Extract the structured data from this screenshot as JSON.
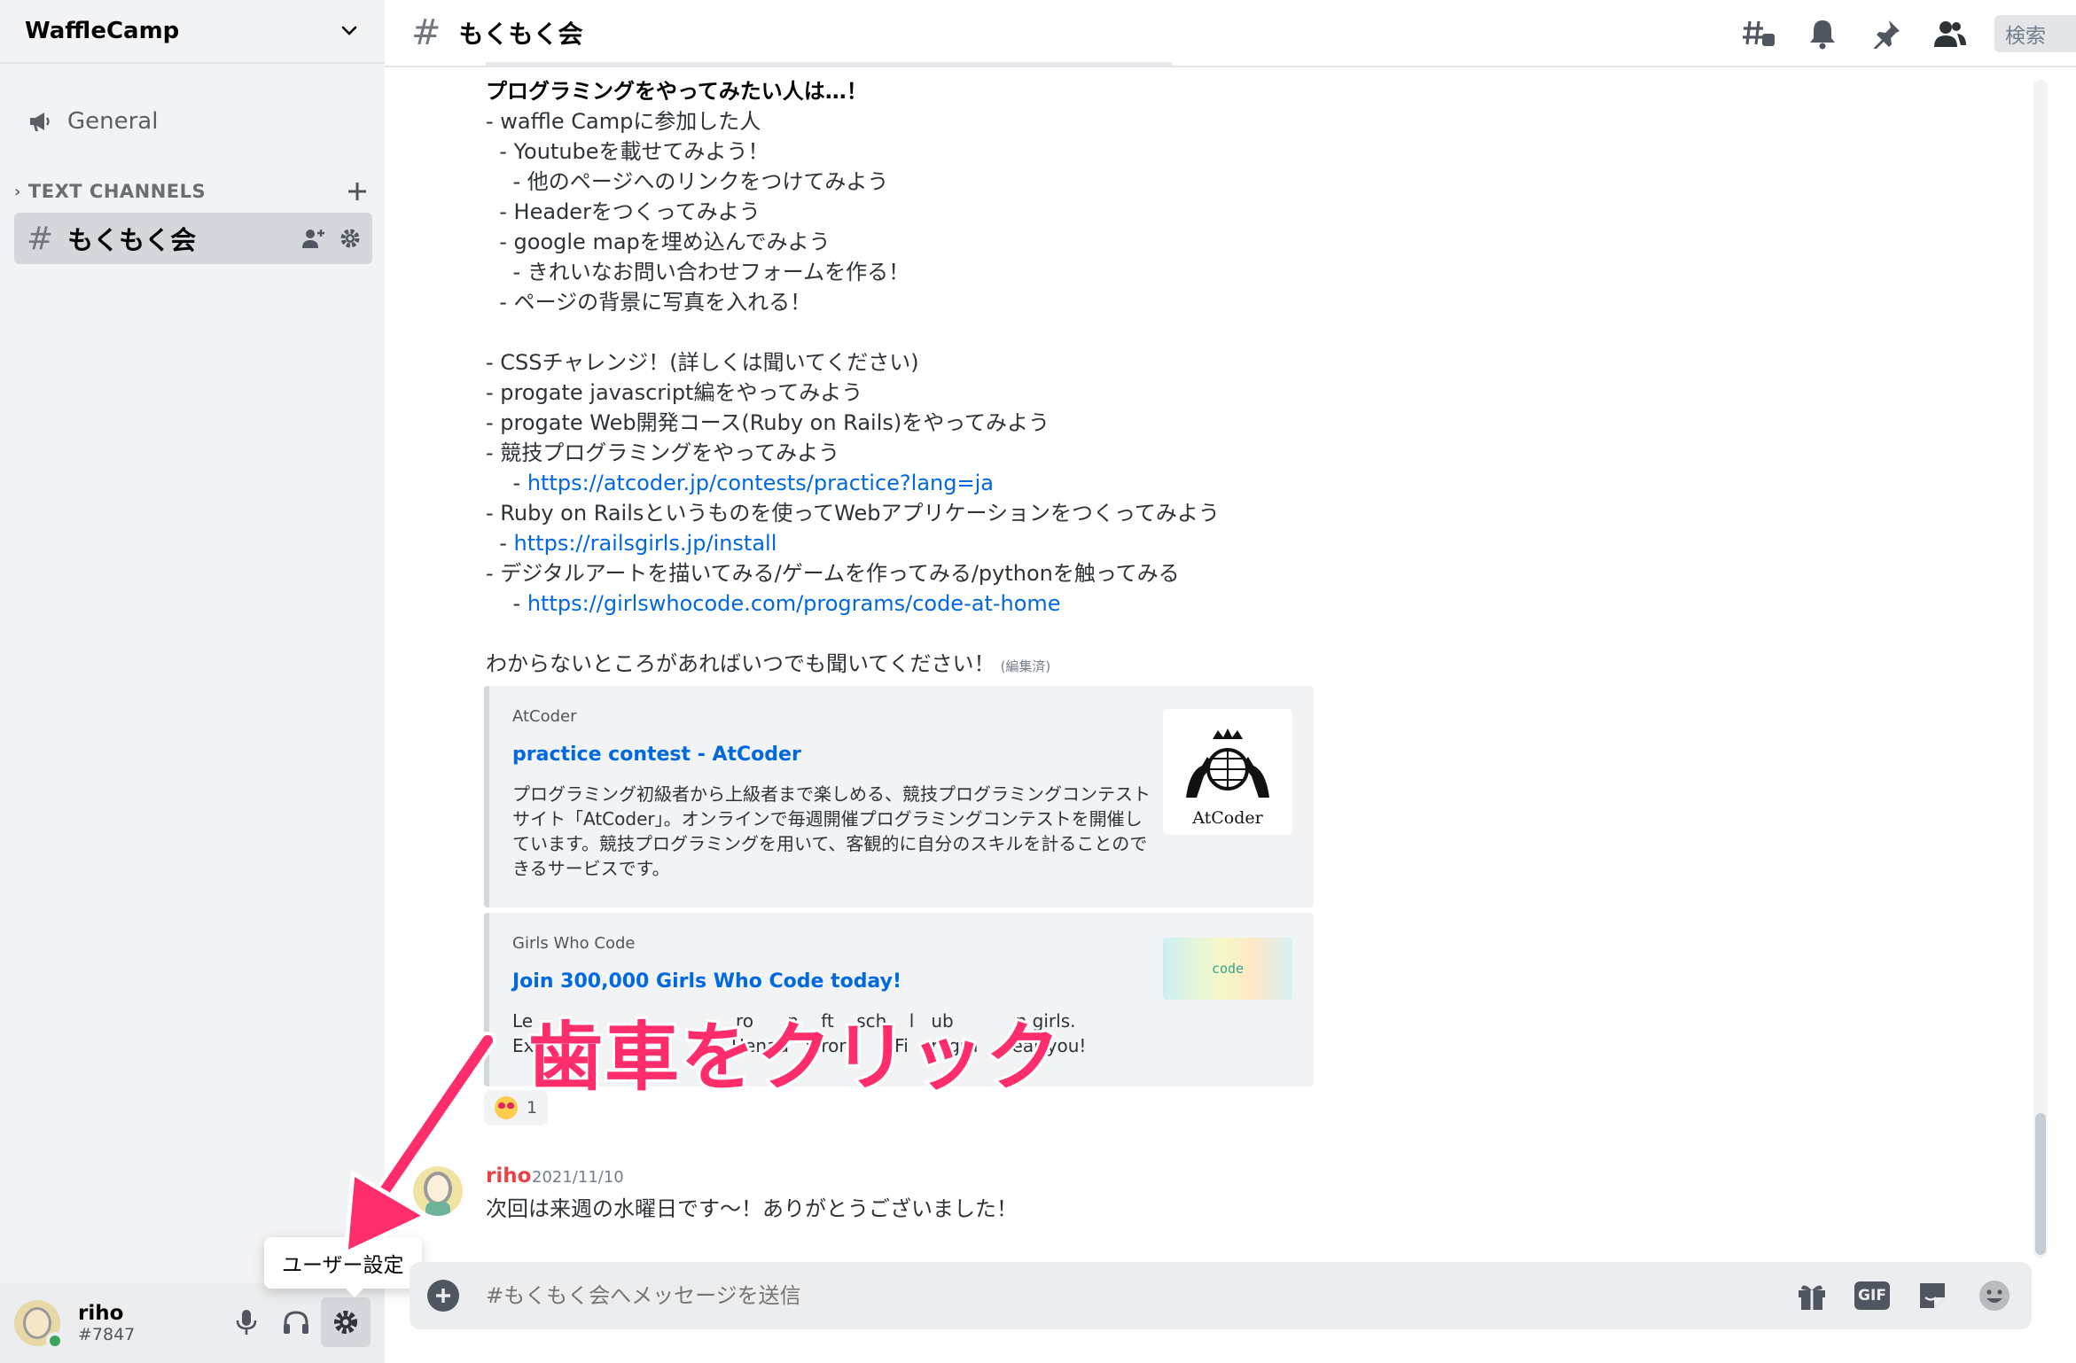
{
  "server": {
    "name": "WaffleCamp"
  },
  "sidebar": {
    "general_label": "General",
    "category_label": "TEXT CHANNELS",
    "active_channel": "もくもく会"
  },
  "user": {
    "name": "riho",
    "tag": "#7847",
    "tooltip": "ユーザー設定"
  },
  "header": {
    "channel": "もくもく会",
    "search_label": "検索"
  },
  "message": {
    "lines": [
      {
        "text": "プログラミングをやってみたい人は…！",
        "style": "bold"
      },
      {
        "text": "- waffle Campに参加した人"
      },
      {
        "text": "  - Youtubeを載せてみよう！"
      },
      {
        "text": "    - 他のページへのリンクをつけてみよう"
      },
      {
        "text": "  - Headerをつくってみよう"
      },
      {
        "text": "  - google mapを埋め込んでみよう"
      },
      {
        "text": "    - きれいなお問い合わせフォームを作る！"
      },
      {
        "text": "  - ページの背景に写真を入れる！"
      },
      {
        "text": ""
      },
      {
        "text": "- CSSチャレンジ！(詳しくは聞いてください)"
      },
      {
        "text": "- progate javascript編をやってみよう"
      },
      {
        "text": "- progate Web開発コース(Ruby on Rails)をやってみよう"
      },
      {
        "text": "- 競技プログラミングをやってみよう"
      },
      {
        "text": "    - ",
        "link": "https://atcoder.jp/contests/practice?lang=ja"
      },
      {
        "text": "- Ruby on Railsというものを使ってWebアプリケーションをつくってみよう"
      },
      {
        "text": "  - ",
        "link": "https://railsgirls.jp/install"
      },
      {
        "text": "- デジタルアートを描いてみる/ゲームを作ってみる/pythonを触ってみる"
      },
      {
        "text": "    - ",
        "link": "https://girlswhocode.com/programs/code-at-home"
      },
      {
        "text": ""
      },
      {
        "text": "わからないところがあればいつでも聞いてください！",
        "edited": "(編集済)"
      }
    ]
  },
  "embeds": {
    "atcoder": {
      "provider": "AtCoder",
      "title": "practice contest - AtCoder",
      "description": "プログラミング初級者から上級者まで楽しめる、競技プログラミングコンテストサイト「AtCoder」。オンラインで毎週開催プログラミングコンテストを開催しています。競技プログラミングを用いて、客観的に自分のスキルを計ることのできるサービスです。",
      "thumb_label": "AtCoder"
    },
    "gwc": {
      "provider": "Girls Who Code",
      "title": "Join 300,000 Girls Who Code today!",
      "desc_line1": "Le                                    ro      n    ft    sch    l   ub           n girls.",
      "desc_line2": "Ex                                   Henau   vironi     . Fi    rogra      ear you!",
      "thumb_label": "code"
    }
  },
  "reaction": {
    "count": "1"
  },
  "last_message": {
    "author": "riho",
    "time": "2021/11/10",
    "text": "次回は来週の水曜日です〜！ありがとうございました！"
  },
  "composer": {
    "placeholder": "#もくもく会へメッセージを送信",
    "gif_label": "GIF"
  },
  "annotation": {
    "text": "歯車をクリック",
    "color": "#ff2d6c"
  },
  "colors": {
    "link": "#0068e0",
    "author": "#ed4245",
    "online": "#3ba55d"
  }
}
